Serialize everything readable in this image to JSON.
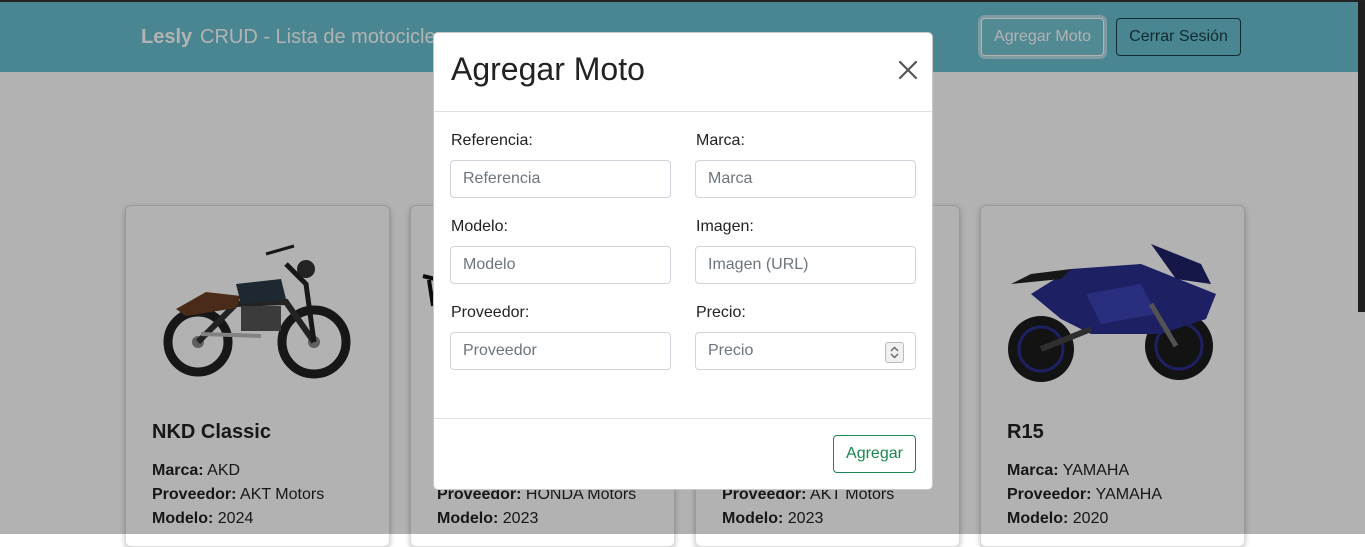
{
  "navbar": {
    "brand": "Lesly",
    "subtitle": "CRUD - Lista de motocicle",
    "add_button": "Agregar Moto",
    "logout_button": "Cerrar Sesión"
  },
  "cards": [
    {
      "title": "NKD Classic",
      "marca_label": "Marca:",
      "marca": "AKD",
      "proveedor_label": "Proveedor:",
      "proveedor": "AKT Motors",
      "modelo_label": "Modelo:",
      "modelo": "2024"
    },
    {
      "proveedor_label": "Proveedor:",
      "proveedor": "HONDA Motors",
      "modelo_label": "Modelo:",
      "modelo": "2023"
    },
    {
      "proveedor_label": "Proveedor:",
      "proveedor": "AKT Motors",
      "modelo_label": "Modelo:",
      "modelo": "2023"
    },
    {
      "title": "R15",
      "marca_label": "Marca:",
      "marca": "YAMAHA",
      "proveedor_label": "Proveedor:",
      "proveedor": "YAMAHA",
      "modelo_label": "Modelo:",
      "modelo": "2020"
    }
  ],
  "modal": {
    "title": "Agregar Moto",
    "fields": {
      "referencia": {
        "label": "Referencia:",
        "placeholder": "Referencia",
        "value": ""
      },
      "marca": {
        "label": "Marca:",
        "placeholder": "Marca",
        "value": ""
      },
      "modelo": {
        "label": "Modelo:",
        "placeholder": "Modelo",
        "value": ""
      },
      "imagen": {
        "label": "Imagen:",
        "placeholder": "Imagen (URL)",
        "value": ""
      },
      "proveedor": {
        "label": "Proveedor:",
        "placeholder": "Proveedor",
        "value": ""
      },
      "precio": {
        "label": "Precio:",
        "placeholder": "Precio",
        "value": ""
      }
    },
    "submit_label": "Agregar"
  },
  "colors": {
    "navbar": "#6bc1d0",
    "success": "#198754",
    "yamaha_blue": "#2a2f8f"
  },
  "icons": {
    "close": "close-icon",
    "spinner": "number-spinner-icon"
  }
}
